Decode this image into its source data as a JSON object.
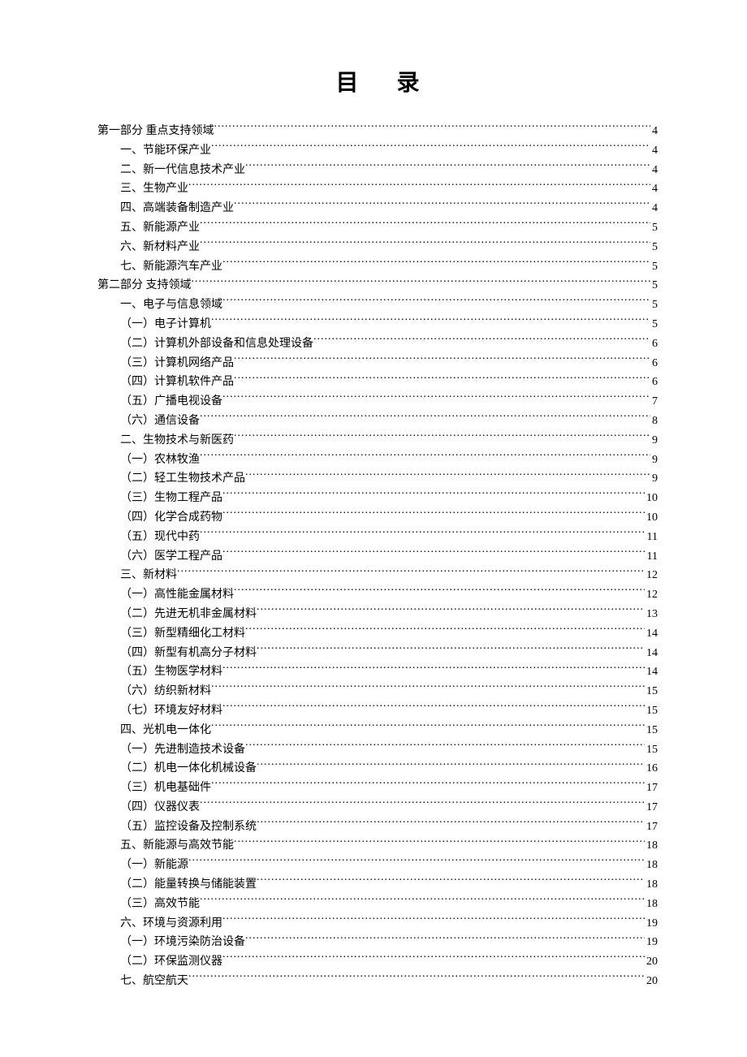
{
  "title": "目 录",
  "entries": [
    {
      "label": "第一部分  重点支持领域",
      "page": "4",
      "indent": 0
    },
    {
      "label": "一、节能环保产业",
      "page": "4",
      "indent": 1
    },
    {
      "label": "二、新一代信息技术产业",
      "page": "4",
      "indent": 1
    },
    {
      "label": "三、生物产业",
      "page": "4",
      "indent": 1
    },
    {
      "label": "四、高端装备制造产业",
      "page": "4",
      "indent": 1
    },
    {
      "label": "五、新能源产业",
      "page": "5",
      "indent": 1
    },
    {
      "label": "六、新材料产业",
      "page": "5",
      "indent": 1
    },
    {
      "label": "七、新能源汽车产业",
      "page": "5",
      "indent": 1
    },
    {
      "label": "第二部分  支持领域",
      "page": "5",
      "indent": 0
    },
    {
      "label": "一、电子与信息领域",
      "page": "5",
      "indent": 1
    },
    {
      "label": "（一）电子计算机",
      "page": "5",
      "indent": 2
    },
    {
      "label": "（二）计算机外部设备和信息处理设备",
      "page": "6",
      "indent": 2
    },
    {
      "label": "（三）计算机网络产品",
      "page": "6",
      "indent": 2
    },
    {
      "label": "（四）计算机软件产品",
      "page": "6",
      "indent": 2
    },
    {
      "label": "（五）广播电视设备",
      "page": "7",
      "indent": 2
    },
    {
      "label": "（六）通信设备",
      "page": "8",
      "indent": 2
    },
    {
      "label": "二、生物技术与新医药",
      "page": "9",
      "indent": 1
    },
    {
      "label": "（一）农林牧渔",
      "page": "9",
      "indent": 2
    },
    {
      "label": "（二）轻工生物技术产品",
      "page": "9",
      "indent": 2
    },
    {
      "label": "（三）生物工程产品",
      "page": "10",
      "indent": 2
    },
    {
      "label": "（四）化学合成药物",
      "page": "10",
      "indent": 2
    },
    {
      "label": "（五）现代中药",
      "page": "11",
      "indent": 2
    },
    {
      "label": "（六）医学工程产品",
      "page": "11",
      "indent": 2
    },
    {
      "label": "三、新材料",
      "page": "12",
      "indent": 1
    },
    {
      "label": "（一）高性能金属材料",
      "page": "12",
      "indent": 2
    },
    {
      "label": "（二）先进无机非金属材料",
      "page": "13",
      "indent": 2
    },
    {
      "label": "（三）新型精细化工材料",
      "page": "14",
      "indent": 2
    },
    {
      "label": "（四）新型有机高分子材料",
      "page": "14",
      "indent": 2
    },
    {
      "label": "（五）生物医学材料",
      "page": "14",
      "indent": 2
    },
    {
      "label": "（六）纺织新材料",
      "page": "15",
      "indent": 2
    },
    {
      "label": "（七）环境友好材料",
      "page": "15",
      "indent": 2
    },
    {
      "label": "四、光机电一体化",
      "page": "15",
      "indent": 1
    },
    {
      "label": "（一）先进制造技术设备",
      "page": "15",
      "indent": 2
    },
    {
      "label": "（二）机电一体化机械设备",
      "page": "16",
      "indent": 2
    },
    {
      "label": "（三）机电基础件",
      "page": "17",
      "indent": 2
    },
    {
      "label": "（四）仪器仪表",
      "page": "17",
      "indent": 2
    },
    {
      "label": "（五）监控设备及控制系统",
      "page": "17",
      "indent": 2
    },
    {
      "label": "五、新能源与高效节能",
      "page": "18",
      "indent": 1
    },
    {
      "label": "（一）新能源",
      "page": "18",
      "indent": 2
    },
    {
      "label": "（二）能量转换与储能装置",
      "page": "18",
      "indent": 2
    },
    {
      "label": "（三）高效节能",
      "page": "18",
      "indent": 2
    },
    {
      "label": "六、环境与资源利用",
      "page": "19",
      "indent": 1
    },
    {
      "label": "（一）环境污染防治设备",
      "page": "19",
      "indent": 2
    },
    {
      "label": "（二）环保监测仪器",
      "page": "20",
      "indent": 2
    },
    {
      "label": "七、航空航天",
      "page": "20",
      "indent": 1
    }
  ]
}
